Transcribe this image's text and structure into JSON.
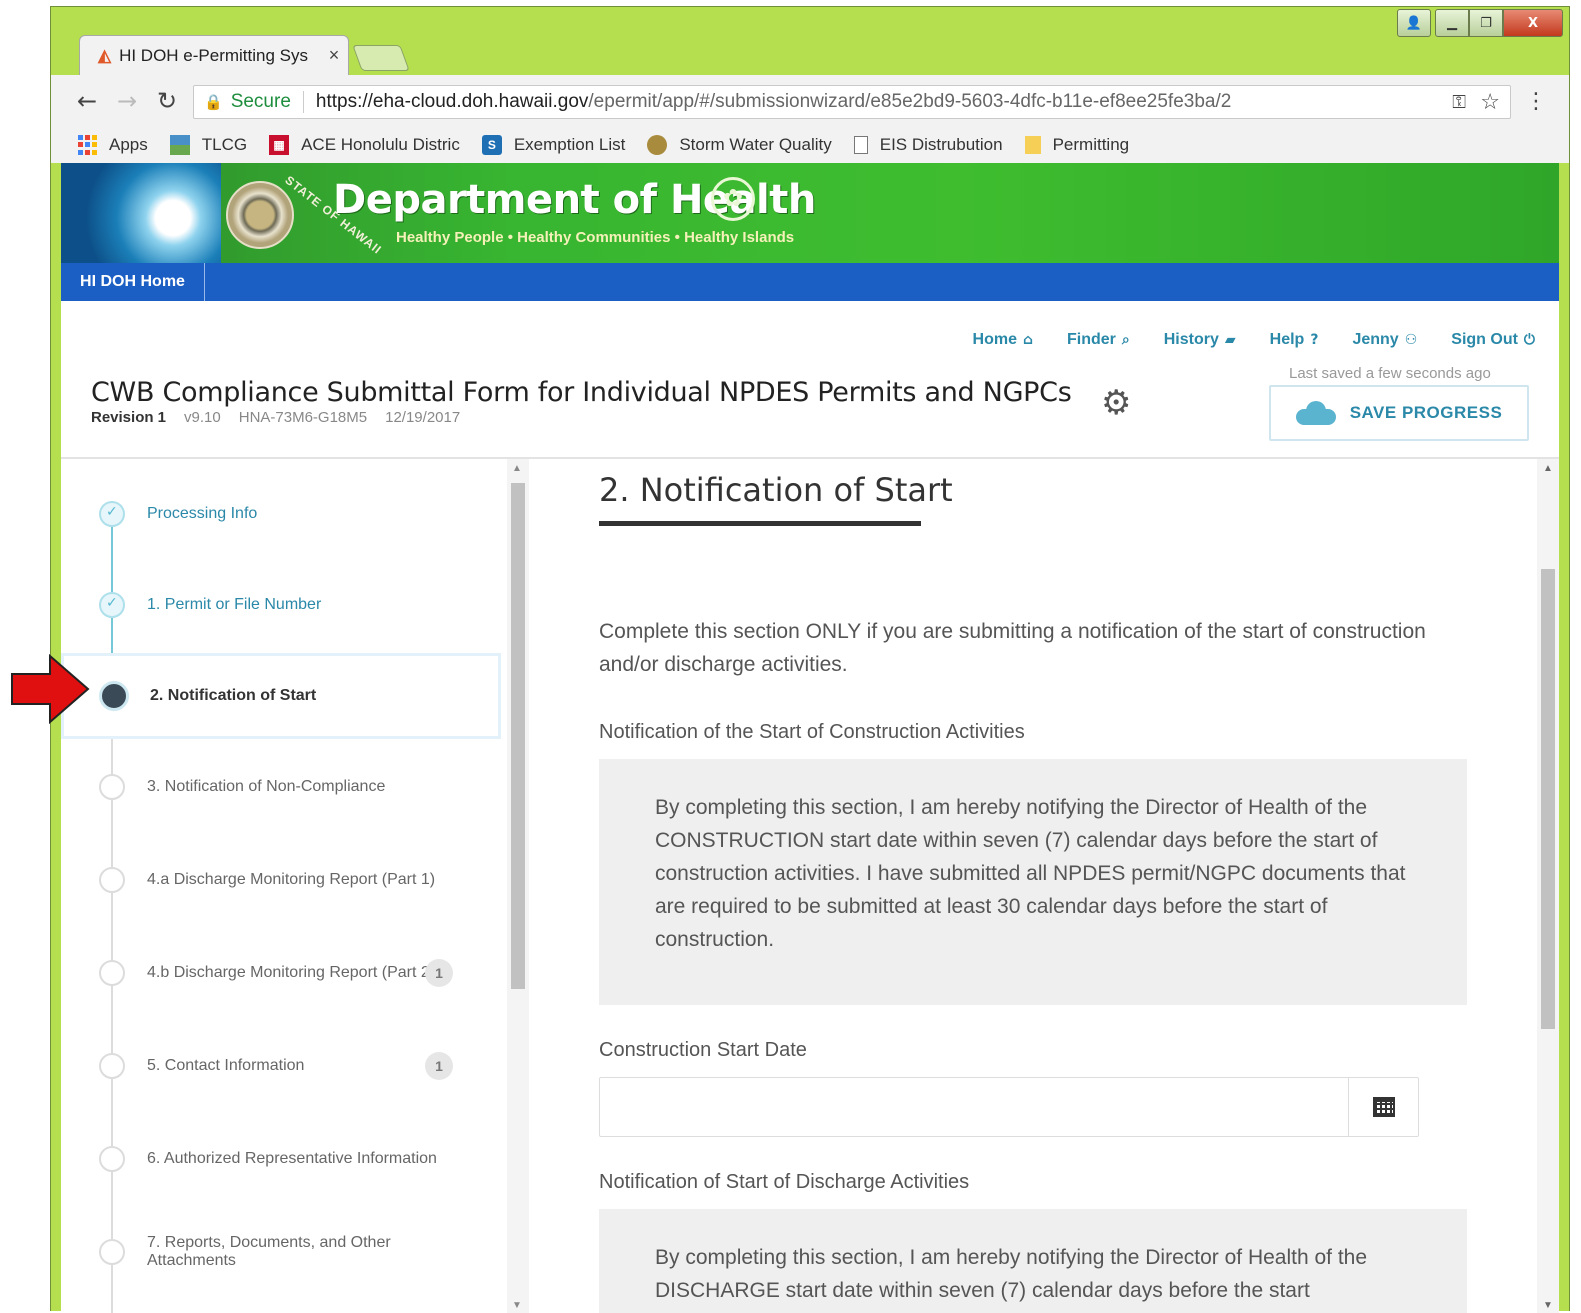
{
  "browser": {
    "tab_title": "HI DOH e-Permitting Sys",
    "tab_close": "×",
    "url_secure": "Secure",
    "url_host": "https://eha-cloud.doh.hawaii.gov",
    "url_path": "/epermit/app/#/submissionwizard/e85e2bd9-5603-4dfc-b11e-ef8ee25fe3ba/2",
    "window_close": "X"
  },
  "bookmarks": [
    {
      "label": "Apps",
      "icon": "apps-grid-icon"
    },
    {
      "label": "TLCG",
      "icon": "folder-image-icon"
    },
    {
      "label": "ACE Honolulu Distric",
      "icon": "castle-icon"
    },
    {
      "label": "Exemption List",
      "icon": "sharepoint-icon"
    },
    {
      "label": "Storm Water Quality",
      "icon": "seal-icon"
    },
    {
      "label": "EIS Distrubution",
      "icon": "page-icon"
    },
    {
      "label": "Permitting",
      "icon": "folder-icon"
    }
  ],
  "banner": {
    "title": "Department of Health",
    "subtitle": "Healthy People • Healthy Communities • Healthy Islands",
    "seal_text": "STATE OF HAWAII"
  },
  "bluebar": {
    "home_link": "HI DOH Home"
  },
  "topnav": [
    {
      "label": "Home",
      "icon": "home-icon"
    },
    {
      "label": "Finder",
      "icon": "search-icon"
    },
    {
      "label": "History",
      "icon": "folder-open-icon"
    },
    {
      "label": "Help",
      "icon": "question-icon"
    },
    {
      "label": "Jenny",
      "icon": "user-icon"
    },
    {
      "label": "Sign Out",
      "icon": "power-icon"
    }
  ],
  "form": {
    "title": "CWB Compliance Submittal Form for Individual NPDES Permits and NGPCs",
    "revision": "Revision 1",
    "version": "v9.10",
    "code": "HNA-73M6-G18M5",
    "date": "12/19/2017",
    "saved_status": "Last saved a few seconds ago",
    "save_button": "SAVE PROGRESS"
  },
  "steps": [
    {
      "label": "Processing Info",
      "state": "done",
      "badge": ""
    },
    {
      "label": "1. Permit or File Number",
      "state": "done",
      "badge": ""
    },
    {
      "label": "2. Notification of Start",
      "state": "active",
      "badge": ""
    },
    {
      "label": "3. Notification of Non-Compliance",
      "state": "todo",
      "badge": ""
    },
    {
      "label": "4.a Discharge Monitoring Report (Part 1)",
      "state": "todo",
      "badge": ""
    },
    {
      "label": "4.b Discharge Monitoring Report (Part 2)",
      "state": "todo",
      "badge": "1"
    },
    {
      "label": "5. Contact Information",
      "state": "todo",
      "badge": "1"
    },
    {
      "label": "6. Authorized Representative Information",
      "state": "todo",
      "badge": ""
    },
    {
      "label": "7. Reports, Documents, and Other Attachments",
      "state": "todo",
      "badge": ""
    }
  ],
  "section": {
    "title": "2. Notification of Start",
    "intro": "Complete this section ONLY if you are submitting a notification of the start of construction and/or discharge activities.",
    "construction_heading": "Notification of the Start of Construction Activities",
    "construction_notice": "By completing this section, I am hereby notifying the Director of Health of the CONSTRUCTION start date within seven (7) calendar days before the start of construction activities. I have submitted all NPDES permit/NGPC documents that are required to be submitted at least 30 calendar days before the start of construction.",
    "date_label": "Construction Start Date",
    "date_value": "",
    "date_placeholder": "",
    "discharge_heading": "Notification of Start of Discharge Activities",
    "discharge_notice": "By completing this section, I am hereby notifying the Director of Health of the DISCHARGE start date within seven (7) calendar days before the start"
  }
}
